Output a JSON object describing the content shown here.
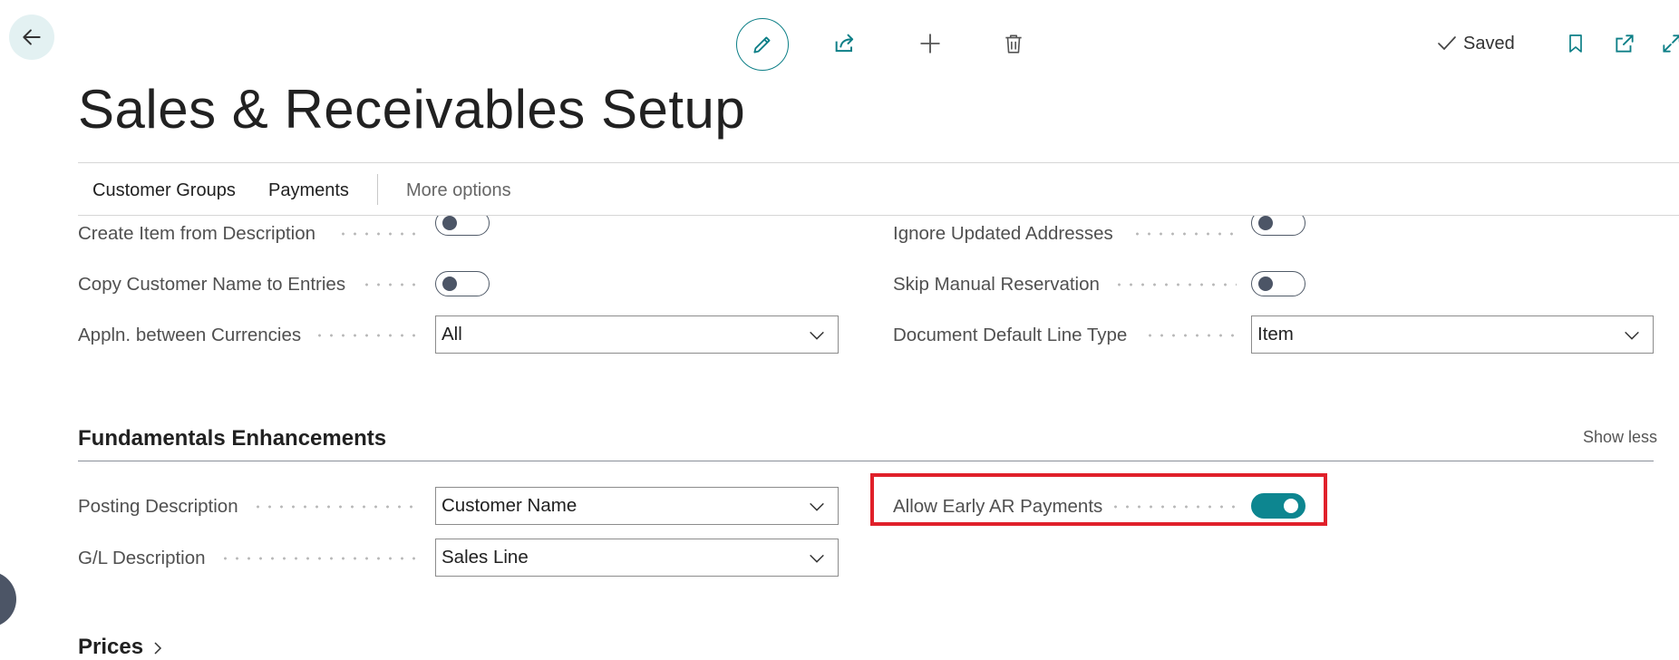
{
  "topbar": {
    "back_icon": "arrow-left-icon",
    "tools": [
      "pencil-icon",
      "share-icon",
      "plus-icon",
      "trash-icon"
    ],
    "saved_label": "Saved",
    "right_icons": [
      "bookmark-icon",
      "open-new-window-icon",
      "expand-icon"
    ]
  },
  "page": {
    "title": "Sales & Receivables Setup"
  },
  "actions": {
    "customer_groups": "Customer Groups",
    "payments": "Payments",
    "more_options": "More options"
  },
  "general_fields": {
    "create_item_from_description": {
      "label": "Create Item from Description",
      "value": false
    },
    "ignore_updated_addresses": {
      "label": "Ignore Updated Addresses",
      "value": false
    },
    "copy_customer_name": {
      "label": "Copy Customer Name to Entries",
      "value": false
    },
    "skip_manual_reservation": {
      "label": "Skip Manual Reservation",
      "value": false
    },
    "appln_between_currencies": {
      "label": "Appln. between Currencies",
      "value": "All"
    },
    "document_default_line_type": {
      "label": "Document Default Line Type",
      "value": "Item"
    }
  },
  "fundamentals": {
    "title": "Fundamentals Enhancements",
    "show_less": "Show less",
    "posting_description": {
      "label": "Posting Description",
      "value": "Customer Name"
    },
    "gl_description": {
      "label": "G/L Description",
      "value": "Sales Line"
    },
    "allow_early_ar_payments": {
      "label": "Allow Early AR Payments",
      "value": true
    }
  },
  "prices": {
    "title": "Prices"
  },
  "colors": {
    "accent": "#0d8690",
    "highlight": "#e0202a",
    "toggle_off": "#4c5566"
  }
}
